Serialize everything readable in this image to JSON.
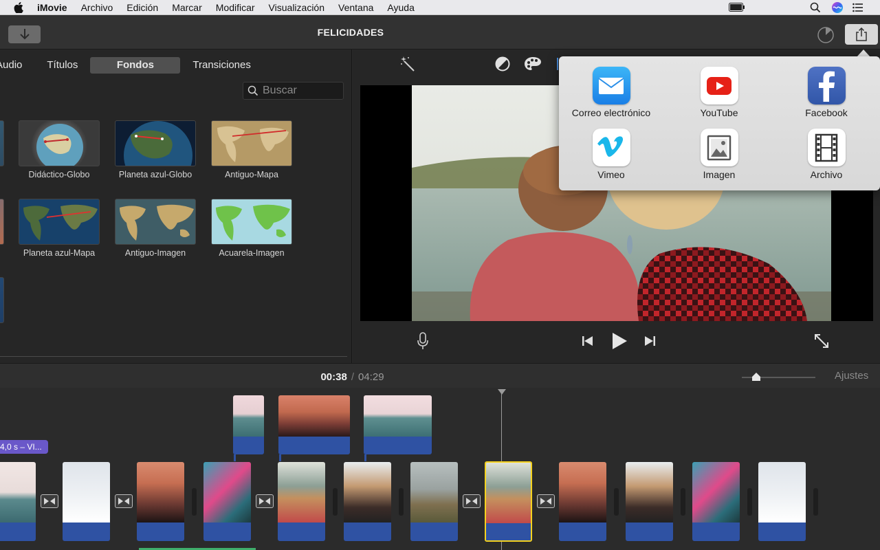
{
  "menubar": {
    "items": [
      "iMovie",
      "Archivo",
      "Edición",
      "Marcar",
      "Modificar",
      "Visualización",
      "Ventana",
      "Ayuda"
    ]
  },
  "toolbar": {
    "project_title": "FELICIDADES"
  },
  "browser": {
    "tabs": [
      "Audio",
      "Títulos",
      "Fondos",
      "Transiciones"
    ],
    "active_tab": "Fondos",
    "search_placeholder": "Buscar",
    "backgrounds": [
      {
        "label": "Didáctico-Globo"
      },
      {
        "label": "Planeta azul-Globo"
      },
      {
        "label": "Antiguo-Mapa"
      },
      {
        "label": "Planeta azul-Mapa"
      },
      {
        "label": "Antiguo-Imagen"
      },
      {
        "label": "Acuarela-Imagen"
      }
    ]
  },
  "timeline": {
    "current_time": "00:38",
    "separator": "/",
    "total_time": "04:29",
    "settings_label": "Ajustes",
    "title_clip_label": "4,0 s – VI..."
  },
  "share": {
    "options": [
      {
        "label": "Correo electrónico",
        "icon": "mail-icon"
      },
      {
        "label": "YouTube",
        "icon": "youtube-icon"
      },
      {
        "label": "Facebook",
        "icon": "facebook-icon"
      },
      {
        "label": "Vimeo",
        "icon": "vimeo-icon"
      },
      {
        "label": "Imagen",
        "icon": "image-icon"
      },
      {
        "label": "Archivo",
        "icon": "film-icon"
      }
    ]
  },
  "colors": {
    "selected_clip_border": "#f5d21e",
    "audio_track": "#2f52a3",
    "title_clip": "#6a58c9",
    "active_tab_bg": "#505050"
  }
}
